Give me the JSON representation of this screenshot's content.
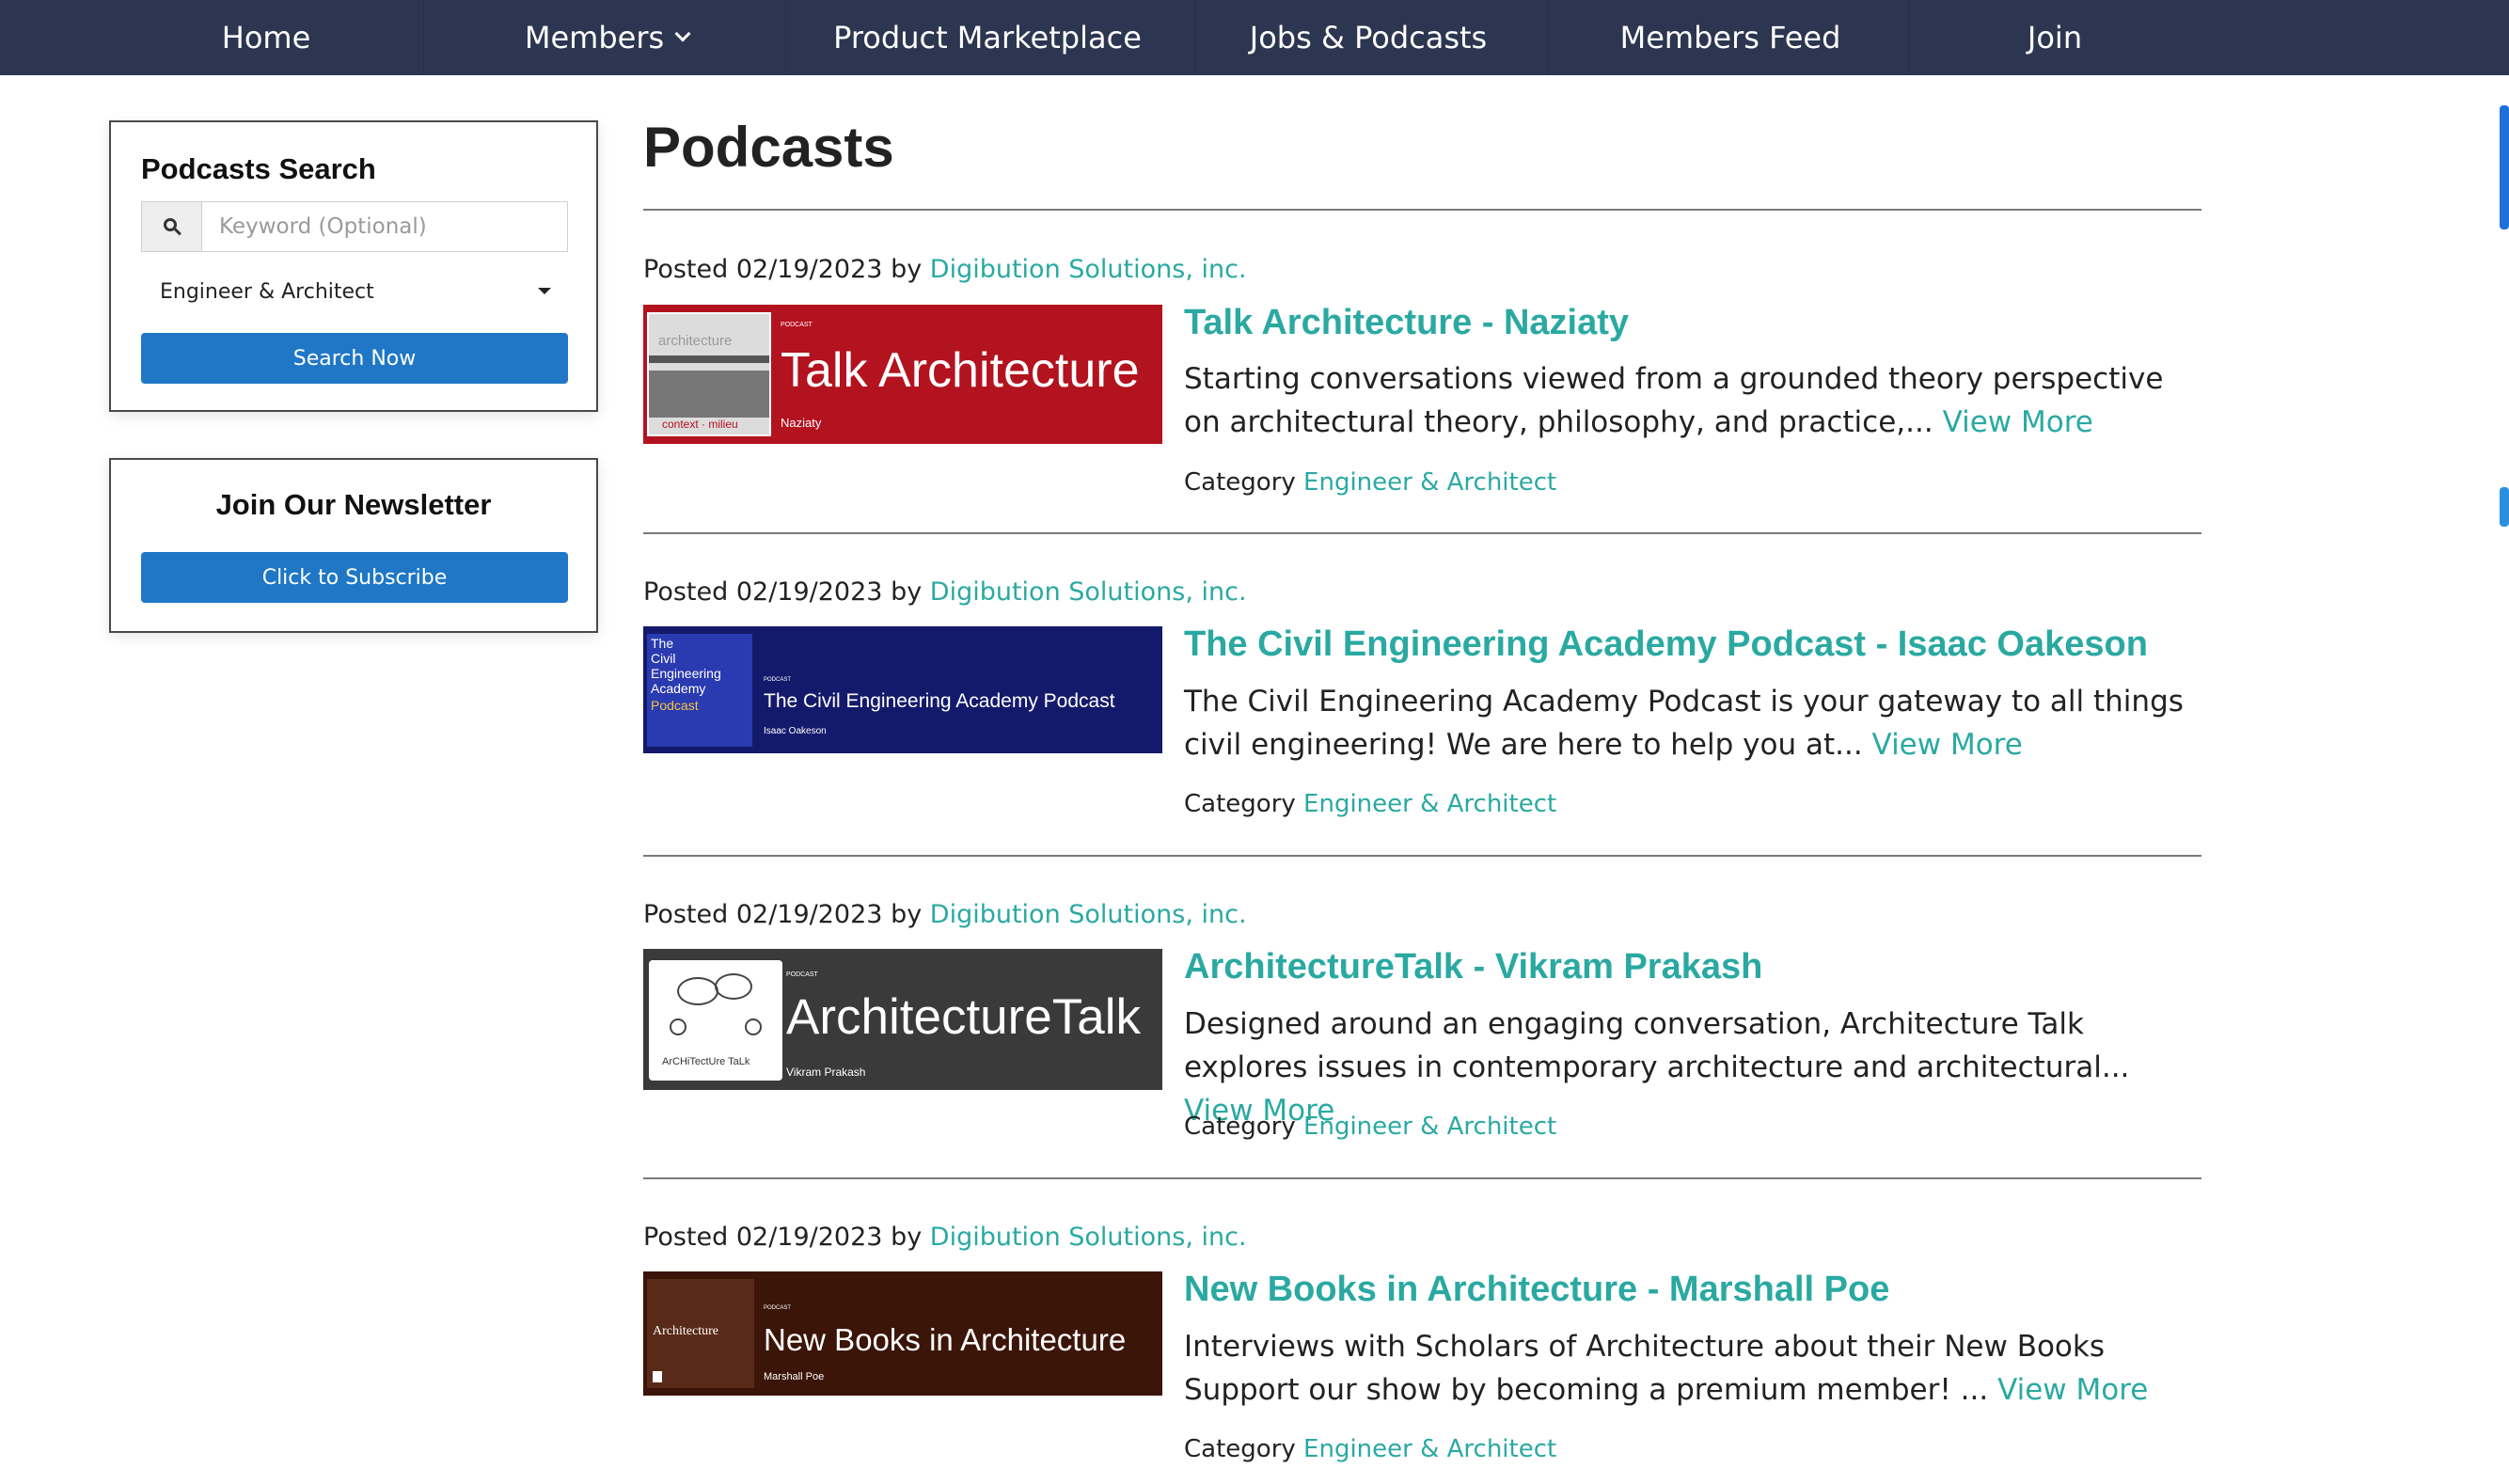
{
  "nav": {
    "items": [
      {
        "label": "Home"
      },
      {
        "label": "Members"
      },
      {
        "label": "Product Marketplace"
      },
      {
        "label": "Jobs & Podcasts"
      },
      {
        "label": "Members Feed"
      },
      {
        "label": "Join"
      }
    ]
  },
  "sidebar": {
    "search": {
      "title": "Podcasts Search",
      "keyword_placeholder": "Keyword (Optional)",
      "keyword_value": "",
      "category_selected": "Engineer & Architect",
      "button_label": "Search Now"
    },
    "newsletter": {
      "title": "Join Our Newsletter",
      "button_label": "Click to Subscribe"
    }
  },
  "main": {
    "title": "Podcasts",
    "posted_prefix": "Posted",
    "by_word": "by",
    "category_prefix": "Category",
    "view_more": "View More",
    "items": [
      {
        "date": "02/19/2023",
        "author": "Digibution Solutions, inc.",
        "title": "Talk Architecture - Naziaty",
        "description": "Starting conversations viewed from a grounded theory perspective on architectural theory, philosophy, and practice,...",
        "category": "Engineer & Architect",
        "thumb": {
          "kicker": "PODCAST",
          "headline": "Talk Architecture",
          "byline": "Naziaty",
          "art_text": "architecture",
          "art_caption": "context · milieu",
          "bg": "#b3121f"
        }
      },
      {
        "date": "02/19/2023",
        "author": "Digibution Solutions, inc.",
        "title": "The Civil Engineering Academy Podcast - Isaac Oakeson",
        "description": "The Civil Engineering Academy Podcast is your gateway to all things civil engineering! We are here to help you at...",
        "category": "Engineer & Architect",
        "thumb": {
          "kicker": "PODCAST",
          "headline": "The Civil Engineering Academy Podcast",
          "byline": "Isaac Oakeson",
          "art_lines": [
            "The",
            "Civil",
            "Engineering",
            "Academy"
          ],
          "art_accent": "Podcast",
          "bg": "#141a6b"
        }
      },
      {
        "date": "02/19/2023",
        "author": "Digibution Solutions, inc.",
        "title": "ArchitectureTalk - Vikram Prakash",
        "description": "Designed around an engaging conversation, Architecture Talk explores issues in contemporary architecture and architectural...",
        "category": "Engineer & Architect",
        "thumb": {
          "kicker": "PODCAST",
          "headline": "ArchitectureTalk",
          "byline": "Vikram Prakash",
          "art_caption": "ArCHiTectUre TaLk",
          "bg": "#3a3a3a"
        }
      },
      {
        "date": "02/19/2023",
        "author": "Digibution Solutions, inc.",
        "title": "New Books in Architecture - Marshall Poe",
        "description": "Interviews with Scholars of Architecture about their New Books Support our show by becoming a premium member! ...",
        "category": "Engineer & Architect",
        "thumb": {
          "kicker": "PODCAST",
          "headline": "New Books in Architecture",
          "byline": "Marshall Poe",
          "art_text": "Architecture",
          "bg": "#3b1508"
        }
      }
    ]
  },
  "colors": {
    "nav_bg": "#2d3650",
    "accent_teal": "#2aa9a2",
    "button_blue": "#1f77c6"
  }
}
